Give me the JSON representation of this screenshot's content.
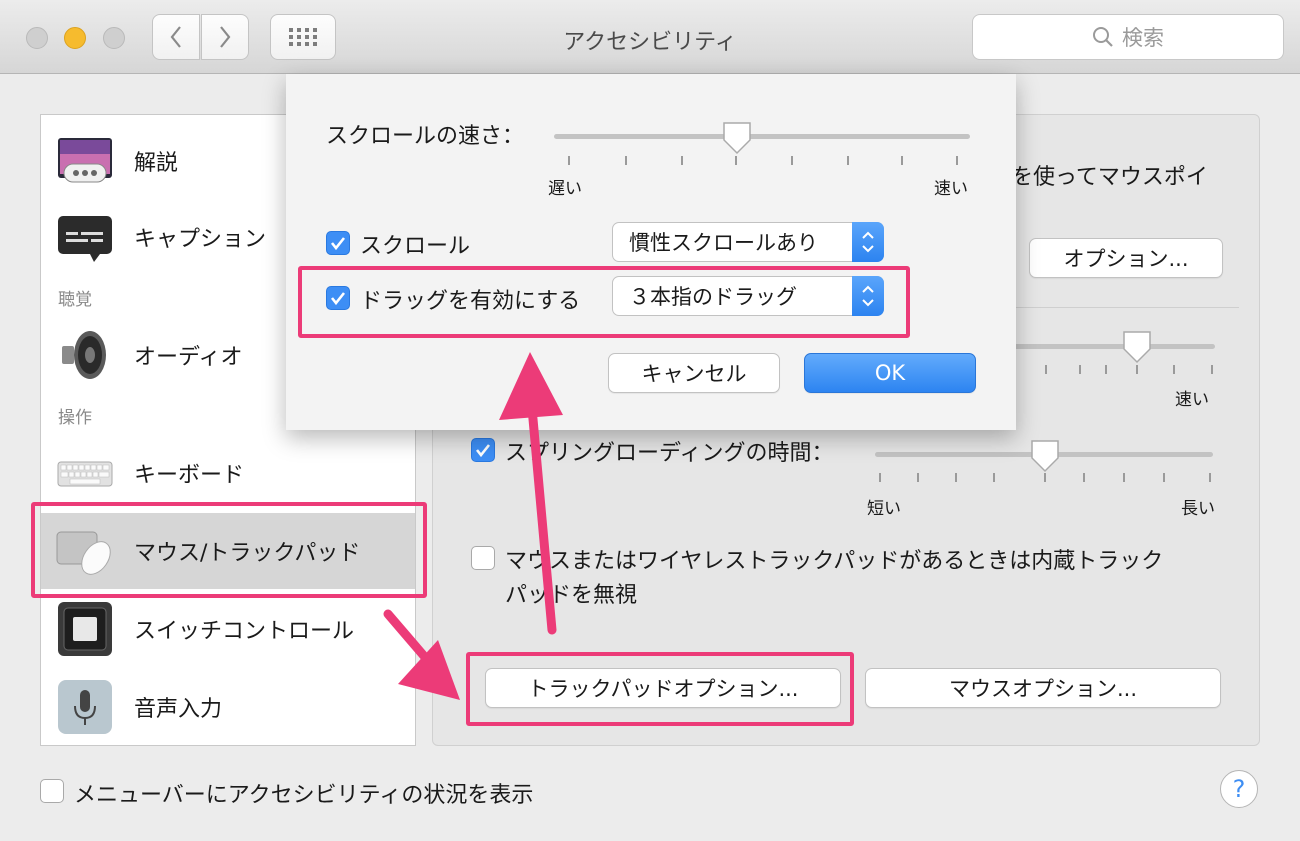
{
  "window": {
    "title": "アクセシビリティ",
    "search_placeholder": "検索"
  },
  "sidebar": {
    "items": [
      {
        "label": "解説",
        "icon": "description-icon"
      },
      {
        "label": "キャプション",
        "icon": "captions-icon"
      },
      {
        "label": "オーディオ",
        "icon": "speaker-icon"
      },
      {
        "label": "キーボード",
        "icon": "keyboard-icon"
      },
      {
        "label": "マウス/トラックパッド",
        "icon": "mouse-trackpad-icon",
        "selected": true
      },
      {
        "label": "スイッチコントロール",
        "icon": "switch-control-icon"
      },
      {
        "label": "音声入力",
        "icon": "microphone-icon"
      }
    ],
    "section_hearing": "聴覚",
    "section_interaction": "操作"
  },
  "main": {
    "partial_text": "を使ってマウスポイ",
    "options_button": "オプション...",
    "fast_label": "速い",
    "spring_loading_label": "スプリングローディングの時間：",
    "spring_loading_checked": true,
    "short_label": "短い",
    "long_label": "長い",
    "ignore_trackpad_line1": "マウスまたはワイヤレストラックパッドがあるときは内蔵トラック",
    "ignore_trackpad_line2": "パッドを無視",
    "ignore_trackpad_checked": false,
    "trackpad_options_button": "トラックパッドオプション...",
    "mouse_options_button": "マウスオプション..."
  },
  "dialog": {
    "scroll_speed_label": "スクロールの速さ：",
    "slow_label": "遅い",
    "fast_label": "速い",
    "scroll_speed_value": 0.44,
    "scroll_checkbox_label": "スクロール",
    "scroll_checked": true,
    "scroll_popup_value": "慣性スクロールあり",
    "drag_checkbox_label": "ドラッグを有効にする",
    "drag_checked": true,
    "drag_popup_value": "３本指のドラッグ",
    "cancel_button": "キャンセル",
    "ok_button": "OK"
  },
  "footer": {
    "menubar_checkbox_label": "メニューバーにアクセシビリティの状況を表示",
    "menubar_checked": false,
    "help_button": "?"
  },
  "colors": {
    "highlight": "#ec3b78",
    "accent": "#3d8ef5",
    "close": "#c9c9c9",
    "minimize": "#f6bb2e"
  }
}
